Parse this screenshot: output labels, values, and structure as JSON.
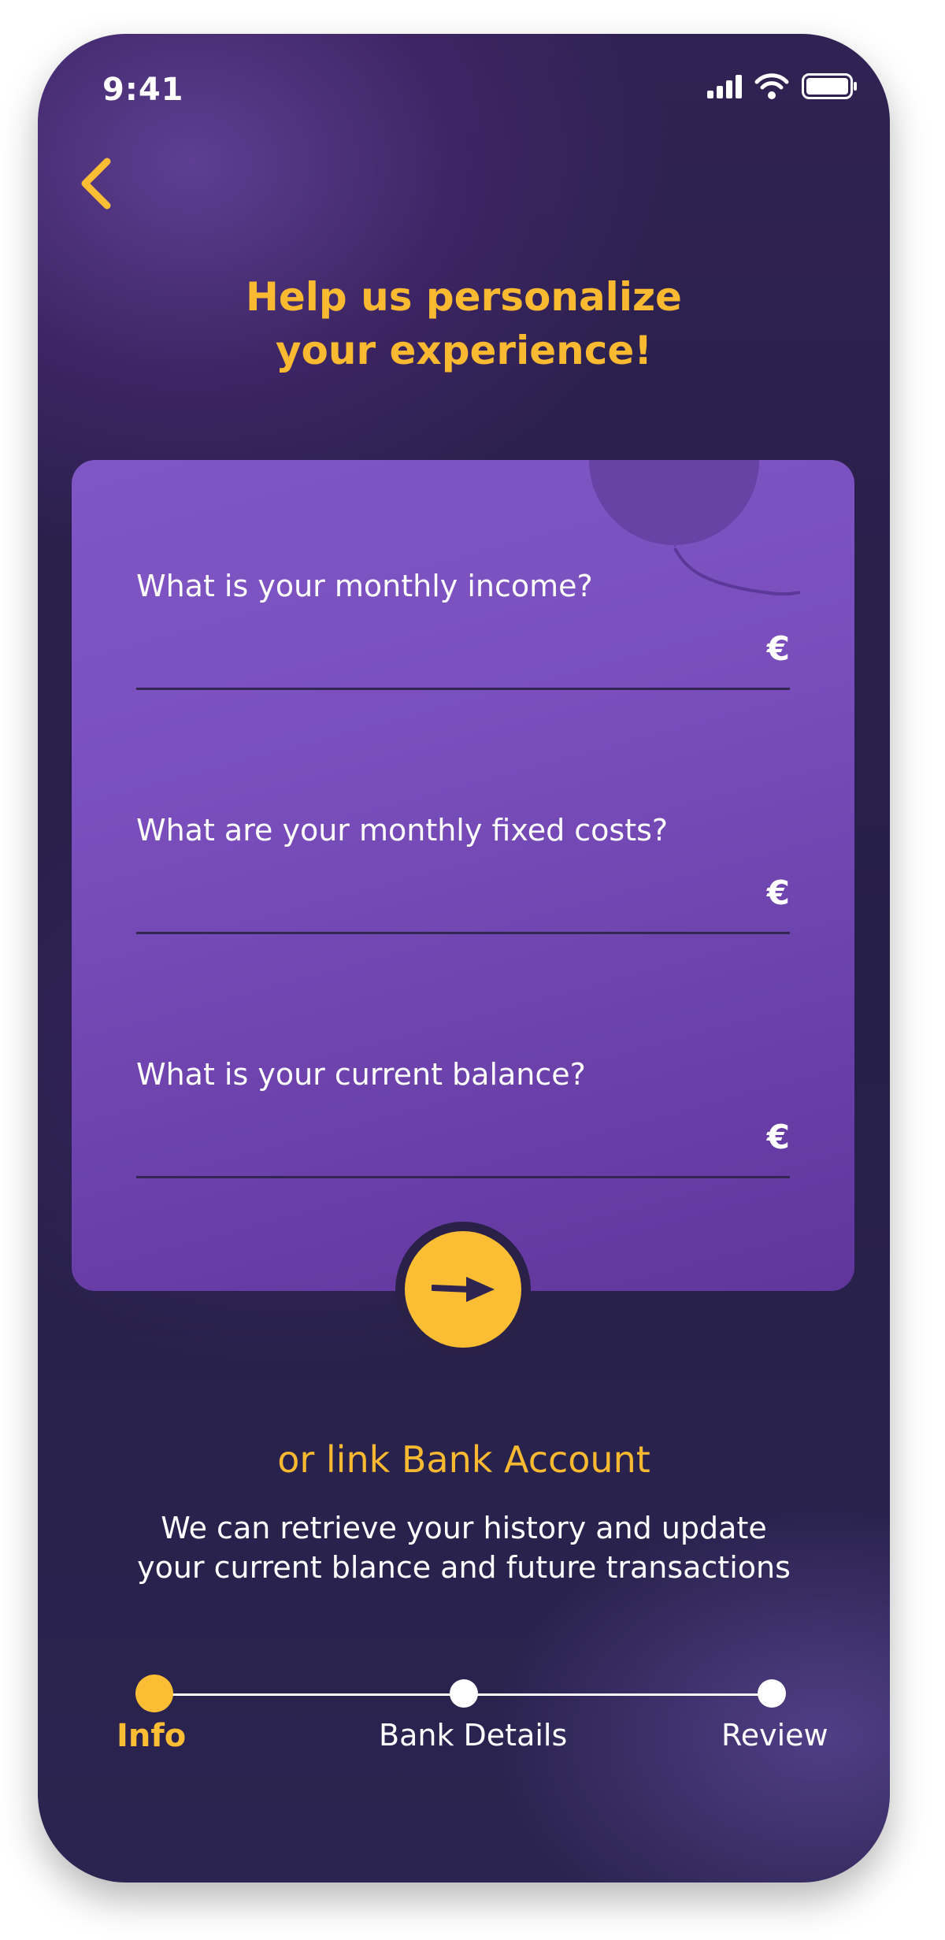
{
  "status_bar": {
    "time": "9:41"
  },
  "header": {
    "title_line1": "Help us personalize",
    "title_line2": "your experience!"
  },
  "form": {
    "fields": [
      {
        "label": "What is your monthly income?",
        "value": "",
        "currency": "€"
      },
      {
        "label": "What are your monthly fixed costs?",
        "value": "",
        "currency": "€"
      },
      {
        "label": "What is your current balance?",
        "value": "",
        "currency": "€"
      }
    ]
  },
  "link_bank": {
    "label": "or link Bank Account",
    "description_line1": "We can retrieve your history and update",
    "description_line2": "your current blance and future transactions"
  },
  "steps": [
    {
      "label": "Info",
      "active": true
    },
    {
      "label": "Bank Details",
      "active": false
    },
    {
      "label": "Review",
      "active": false
    }
  ],
  "colors": {
    "accent": "#fbbd34",
    "card": "#7a4fbd",
    "background": "#261f48"
  },
  "icons": {
    "back": "chevron-left-icon",
    "next": "arrow-right-icon",
    "signal": "cellular-signal-icon",
    "wifi": "wifi-icon",
    "battery": "battery-icon"
  }
}
